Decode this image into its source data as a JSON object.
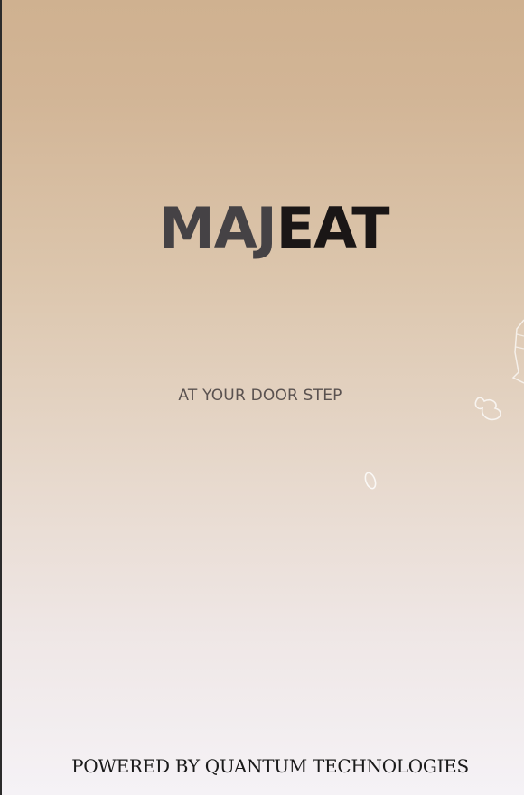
{
  "splash": {
    "logo_part1": "MAJ",
    "logo_part2": "EAT",
    "tagline": "AT YOUR DOOR STEP",
    "footer": "POWERED BY QUANTUM TECHNOLOGIES"
  },
  "colors": {
    "background_top": "#cfb190",
    "background_bottom": "#f5f2f6",
    "logo_primary": "#454245",
    "logo_secondary": "#1a1616",
    "tagline": "#5a5250",
    "footer": "#1a1a1a"
  },
  "decorations": [
    "food-doodle-icon",
    "leaf-doodle-icon",
    "bean-doodle-icon"
  ]
}
